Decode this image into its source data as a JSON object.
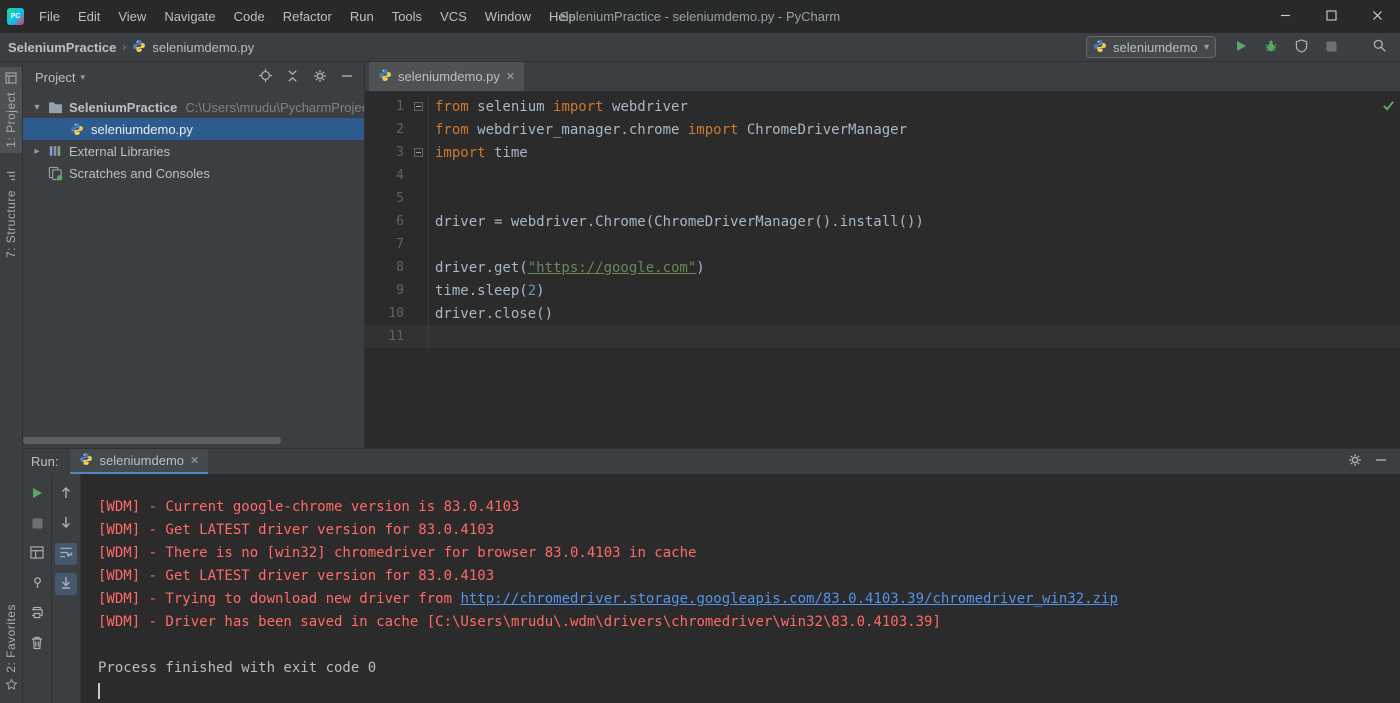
{
  "colors": {
    "titlebar_bg": "#27292a",
    "panel_bg": "#3c3f41",
    "editor_bg": "#2b2b2b",
    "selection_blue": "#2d5b8e",
    "tab_underline_blue": "#4a88c7",
    "run_green": "#59a869",
    "keyword_orange": "#cc7832",
    "code_text": "#a9b7c6",
    "string_green": "#6a8759",
    "number_blue": "#6897bb",
    "console_error_red": "#ff6b68",
    "console_link_blue": "#5394ec",
    "line_number_gray": "#606366"
  },
  "icon_names": [
    "pycharm-logo",
    "python-icon",
    "chevron-down-icon",
    "breadcrumb-separator-icon",
    "run-icon",
    "debug-icon",
    "coverage-icon",
    "stop-icon",
    "search-icon",
    "target-icon",
    "collapse-all-icon",
    "gear-icon",
    "hide-icon",
    "folder-icon",
    "libraries-icon",
    "scratches-icon",
    "inspection-ok-icon",
    "fold-marker-icon",
    "close-icon",
    "minimize-icon",
    "maximize-icon",
    "close-window-icon",
    "rerun-icon",
    "up-stack-icon",
    "down-stack-icon",
    "soft-wrap-icon",
    "scroll-end-icon",
    "restore-layout-icon",
    "pin-icon",
    "printer-icon",
    "clear-icon",
    "star-icon",
    "stripe-project-icon",
    "stripe-structure-icon"
  ],
  "title_bar": {
    "menus": [
      "File",
      "Edit",
      "View",
      "Navigate",
      "Code",
      "Refactor",
      "Run",
      "Tools",
      "VCS",
      "Window",
      "Help"
    ],
    "window_title": "SeleniumPractice - seleniumdemo.py - PyCharm",
    "logo_text": "PC"
  },
  "nav_bar": {
    "breadcrumb_project": "SeleniumPractice",
    "breadcrumb_file": "seleniumdemo.py",
    "run_config_label": "seleniumdemo"
  },
  "tool_stripe": {
    "project": "1: Project",
    "structure": "7: Structure",
    "favorites": "2: Favorites"
  },
  "project_panel": {
    "header_title": "Project",
    "items": [
      {
        "label": "SeleniumPractice",
        "detail": "C:\\Users\\mrudu\\PycharmProject",
        "icon": "folder",
        "expanded": true,
        "bold": true
      },
      {
        "label": "seleniumdemo.py",
        "icon": "python-file",
        "selected": true
      },
      {
        "label": "External Libraries",
        "icon": "libraries",
        "collapsed": true
      },
      {
        "label": "Scratches and Consoles",
        "icon": "scratches"
      }
    ]
  },
  "editor": {
    "tab_label": "seleniumdemo.py",
    "code_lines": [
      {
        "n": "1",
        "fold": true,
        "segs": [
          [
            "kw",
            "from"
          ],
          [
            "pl",
            " selenium "
          ],
          [
            "kw",
            "import"
          ],
          [
            "pl",
            " webdriver"
          ]
        ]
      },
      {
        "n": "2",
        "segs": [
          [
            "kw",
            "from"
          ],
          [
            "pl",
            " webdriver_manager.chrome "
          ],
          [
            "kw",
            "import"
          ],
          [
            "pl",
            " ChromeDriverManager"
          ]
        ]
      },
      {
        "n": "3",
        "fold": true,
        "segs": [
          [
            "kw",
            "import"
          ],
          [
            "pl",
            " time"
          ]
        ]
      },
      {
        "n": "4",
        "segs": []
      },
      {
        "n": "5",
        "segs": []
      },
      {
        "n": "6",
        "segs": [
          [
            "pl",
            "driver = webdriver.Chrome(ChromeDriverManager().install())"
          ]
        ]
      },
      {
        "n": "7",
        "segs": []
      },
      {
        "n": "8",
        "segs": [
          [
            "pl",
            "driver.get("
          ],
          [
            "strlink",
            "\"https://google.com\""
          ],
          [
            "pl",
            ")"
          ]
        ]
      },
      {
        "n": "9",
        "segs": [
          [
            "pl",
            "time.sleep("
          ],
          [
            "num",
            "2"
          ],
          [
            "pl",
            ")"
          ]
        ]
      },
      {
        "n": "10",
        "segs": [
          [
            "pl",
            "driver.close()"
          ]
        ]
      },
      {
        "n": "11",
        "segs": [],
        "current": true
      }
    ]
  },
  "run_panel": {
    "run_label": "Run:",
    "tab_label": "seleniumdemo",
    "console_lines": [
      {
        "segs": [
          [
            "err",
            "[WDM] - Current google-chrome version is 83.0.4103"
          ]
        ]
      },
      {
        "segs": [
          [
            "err",
            "[WDM] - Get LATEST driver version for 83.0.4103"
          ]
        ]
      },
      {
        "segs": [
          [
            "err",
            "[WDM] - There is no [win32] chromedriver for browser 83.0.4103 in cache"
          ]
        ]
      },
      {
        "segs": [
          [
            "err",
            "[WDM] - Get LATEST driver version for 83.0.4103"
          ]
        ]
      },
      {
        "segs": [
          [
            "err",
            "[WDM] - Trying to download new driver from "
          ],
          [
            "link",
            "http://chromedriver.storage.googleapis.com/83.0.4103.39/chromedriver_win32.zip"
          ]
        ]
      },
      {
        "segs": [
          [
            "err",
            "[WDM] - Driver has been saved in cache [C:\\Users\\mrudu\\.wdm\\drivers\\chromedriver\\win32\\83.0.4103.39]"
          ]
        ]
      },
      {
        "segs": []
      },
      {
        "segs": [
          [
            "out",
            "Process finished with exit code 0"
          ]
        ]
      }
    ],
    "show_cursor": true
  }
}
